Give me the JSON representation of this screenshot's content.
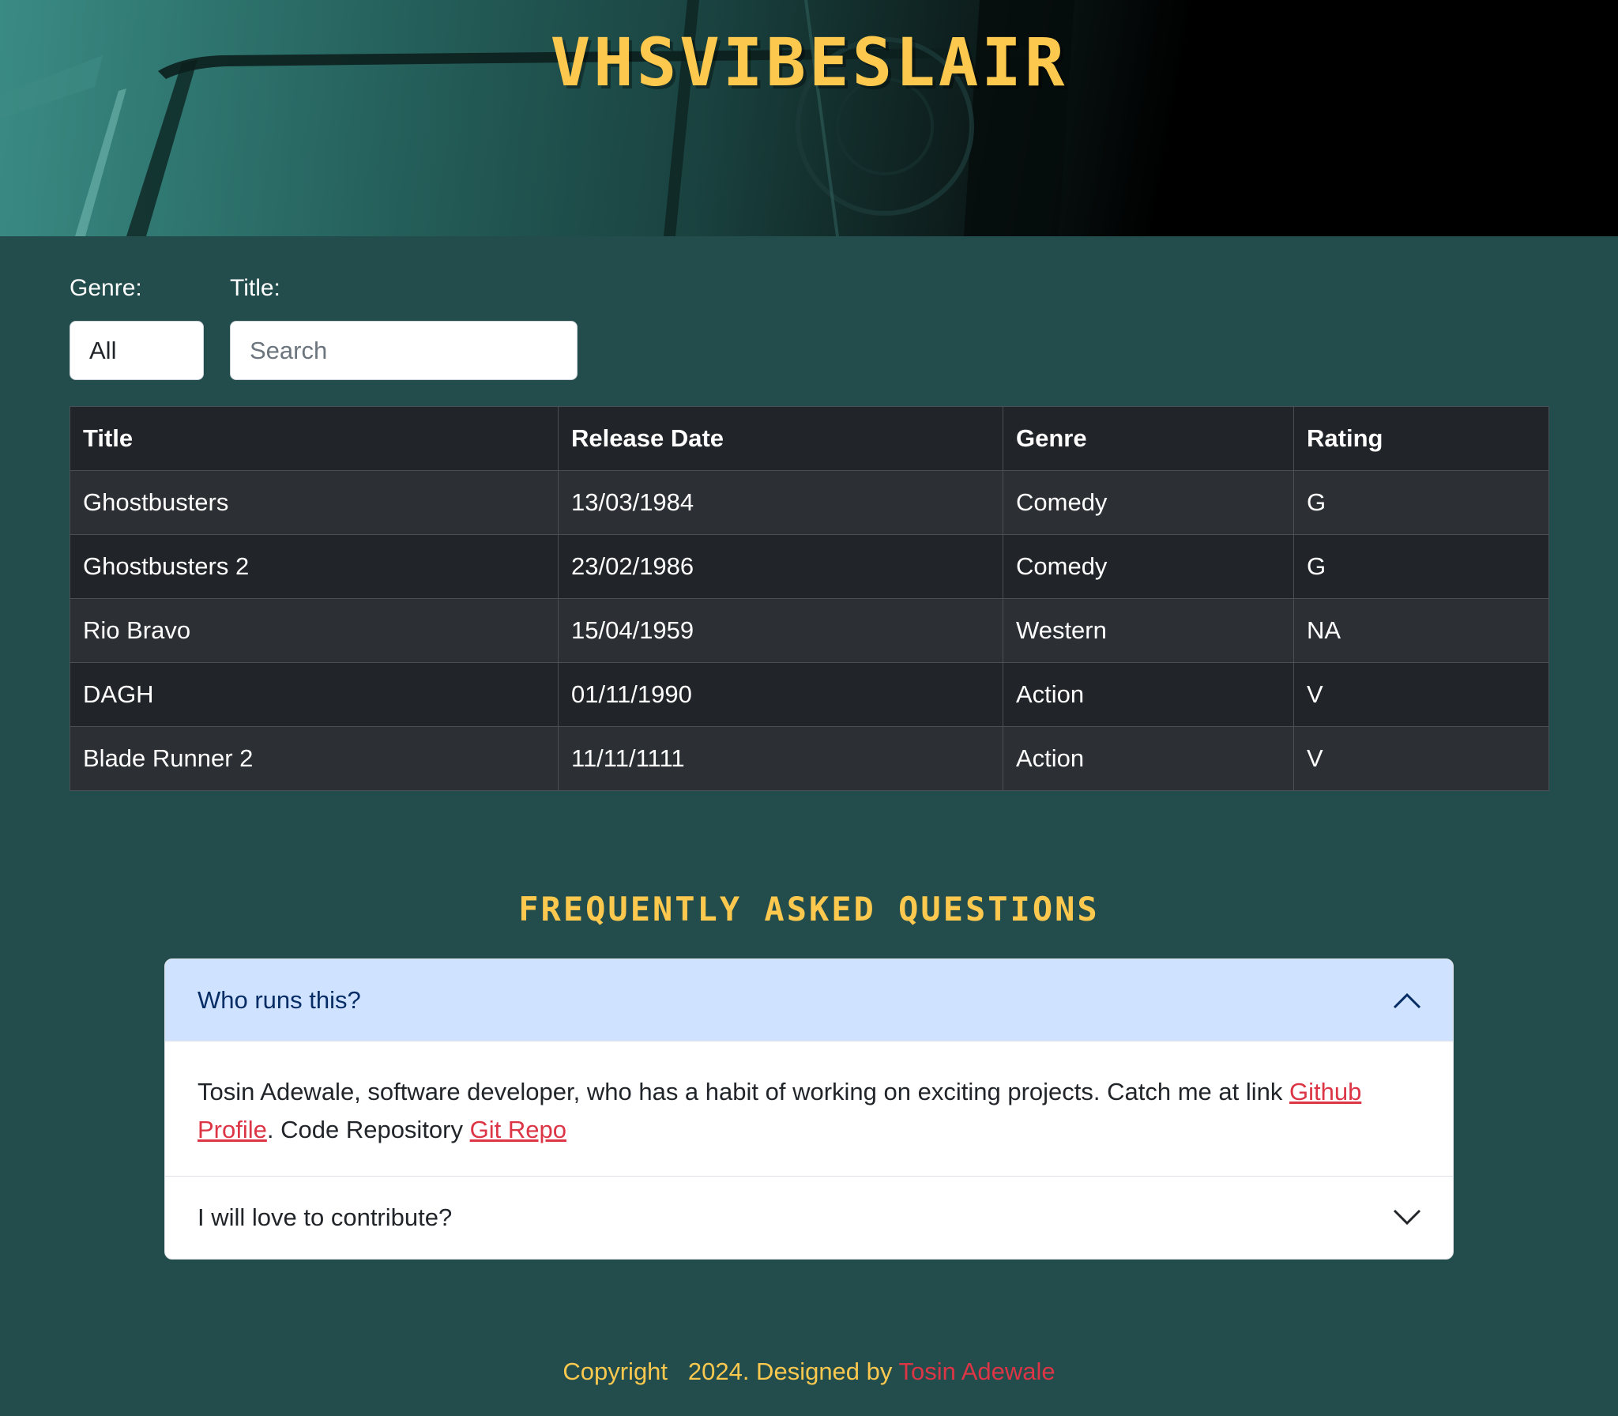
{
  "hero": {
    "title": "VHSVIBESLAIR"
  },
  "filters": {
    "genre_label": "Genre:",
    "genre_value": "All",
    "title_label": "Title:",
    "search_placeholder": "Search"
  },
  "table": {
    "headers": [
      "Title",
      "Release Date",
      "Genre",
      "Rating"
    ],
    "rows": [
      [
        "Ghostbusters",
        "13/03/1984",
        "Comedy",
        "G"
      ],
      [
        "Ghostbusters 2",
        "23/02/1986",
        "Comedy",
        "G"
      ],
      [
        "Rio Bravo",
        "15/04/1959",
        "Western",
        "NA"
      ],
      [
        "DAGH",
        "01/11/1990",
        "Action",
        "V"
      ],
      [
        "Blade Runner 2",
        "11/11/1111",
        "Action",
        "V"
      ]
    ]
  },
  "faq": {
    "heading": "FREQUENTLY ASKED QUESTIONS",
    "items": [
      {
        "question": "Who runs this?",
        "answer_text_1": "Tosin Adewale, software developer, who has a habit of working on exciting projects. Catch me at link ",
        "answer_link_1": "Github Profile",
        "answer_text_2": ". Code Repository ",
        "answer_link_2": "Git Repo",
        "expanded": true
      },
      {
        "question": "I will love to contribute?",
        "expanded": false
      }
    ]
  },
  "footer": {
    "copyright": "Copyright   2024. Designed by ",
    "author": "Tosin Adewale"
  },
  "colors": {
    "background": "#234d4d",
    "accent": "#fcc94e",
    "link": "#dc3545",
    "accordion_open": "#cfe2ff"
  }
}
